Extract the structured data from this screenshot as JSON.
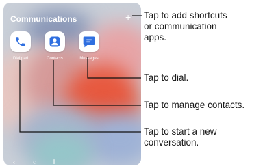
{
  "panel": {
    "title": "Communications",
    "add_symbol": "+",
    "apps": [
      {
        "label": "Dial pad",
        "icon": "phone-icon"
      },
      {
        "label": "Contacts",
        "icon": "person-icon"
      },
      {
        "label": "Messages",
        "icon": "chat-bubble-icon"
      }
    ],
    "nav": {
      "back": "‹",
      "home": "○",
      "recents": "⦀"
    }
  },
  "callouts": {
    "add": [
      "Tap to add shortcuts",
      "or communication",
      "apps."
    ],
    "dial": "Tap to dial.",
    "contacts": "Tap to manage contacts.",
    "conversation": [
      "Tap to start a new",
      "conversation."
    ]
  },
  "colors": {
    "icon_blue": "#2f6fe0",
    "line": "#111111"
  }
}
